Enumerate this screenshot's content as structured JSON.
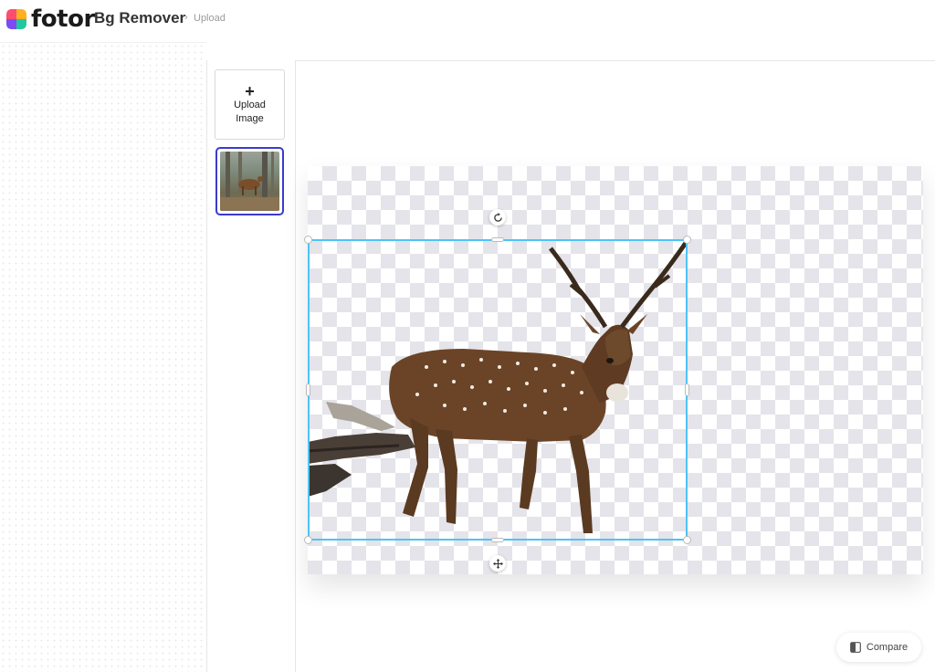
{
  "header": {
    "logo_text": "fotor",
    "product_title": "Bg Remover",
    "breadcrumb_separator": "›",
    "breadcrumb": "Upload"
  },
  "sidebar": {
    "upload_plus": "+",
    "upload_label_line1": "Upload",
    "upload_label_line2": "Image"
  },
  "canvas": {
    "rotate_icon": "rotate-icon",
    "move_icon": "move-icon"
  },
  "footer": {
    "compare_label": "Compare"
  },
  "colors": {
    "selection": "#4fc3f7",
    "thumb_selected_border": "#3b3bd1",
    "checker": "#e4e4ea"
  }
}
